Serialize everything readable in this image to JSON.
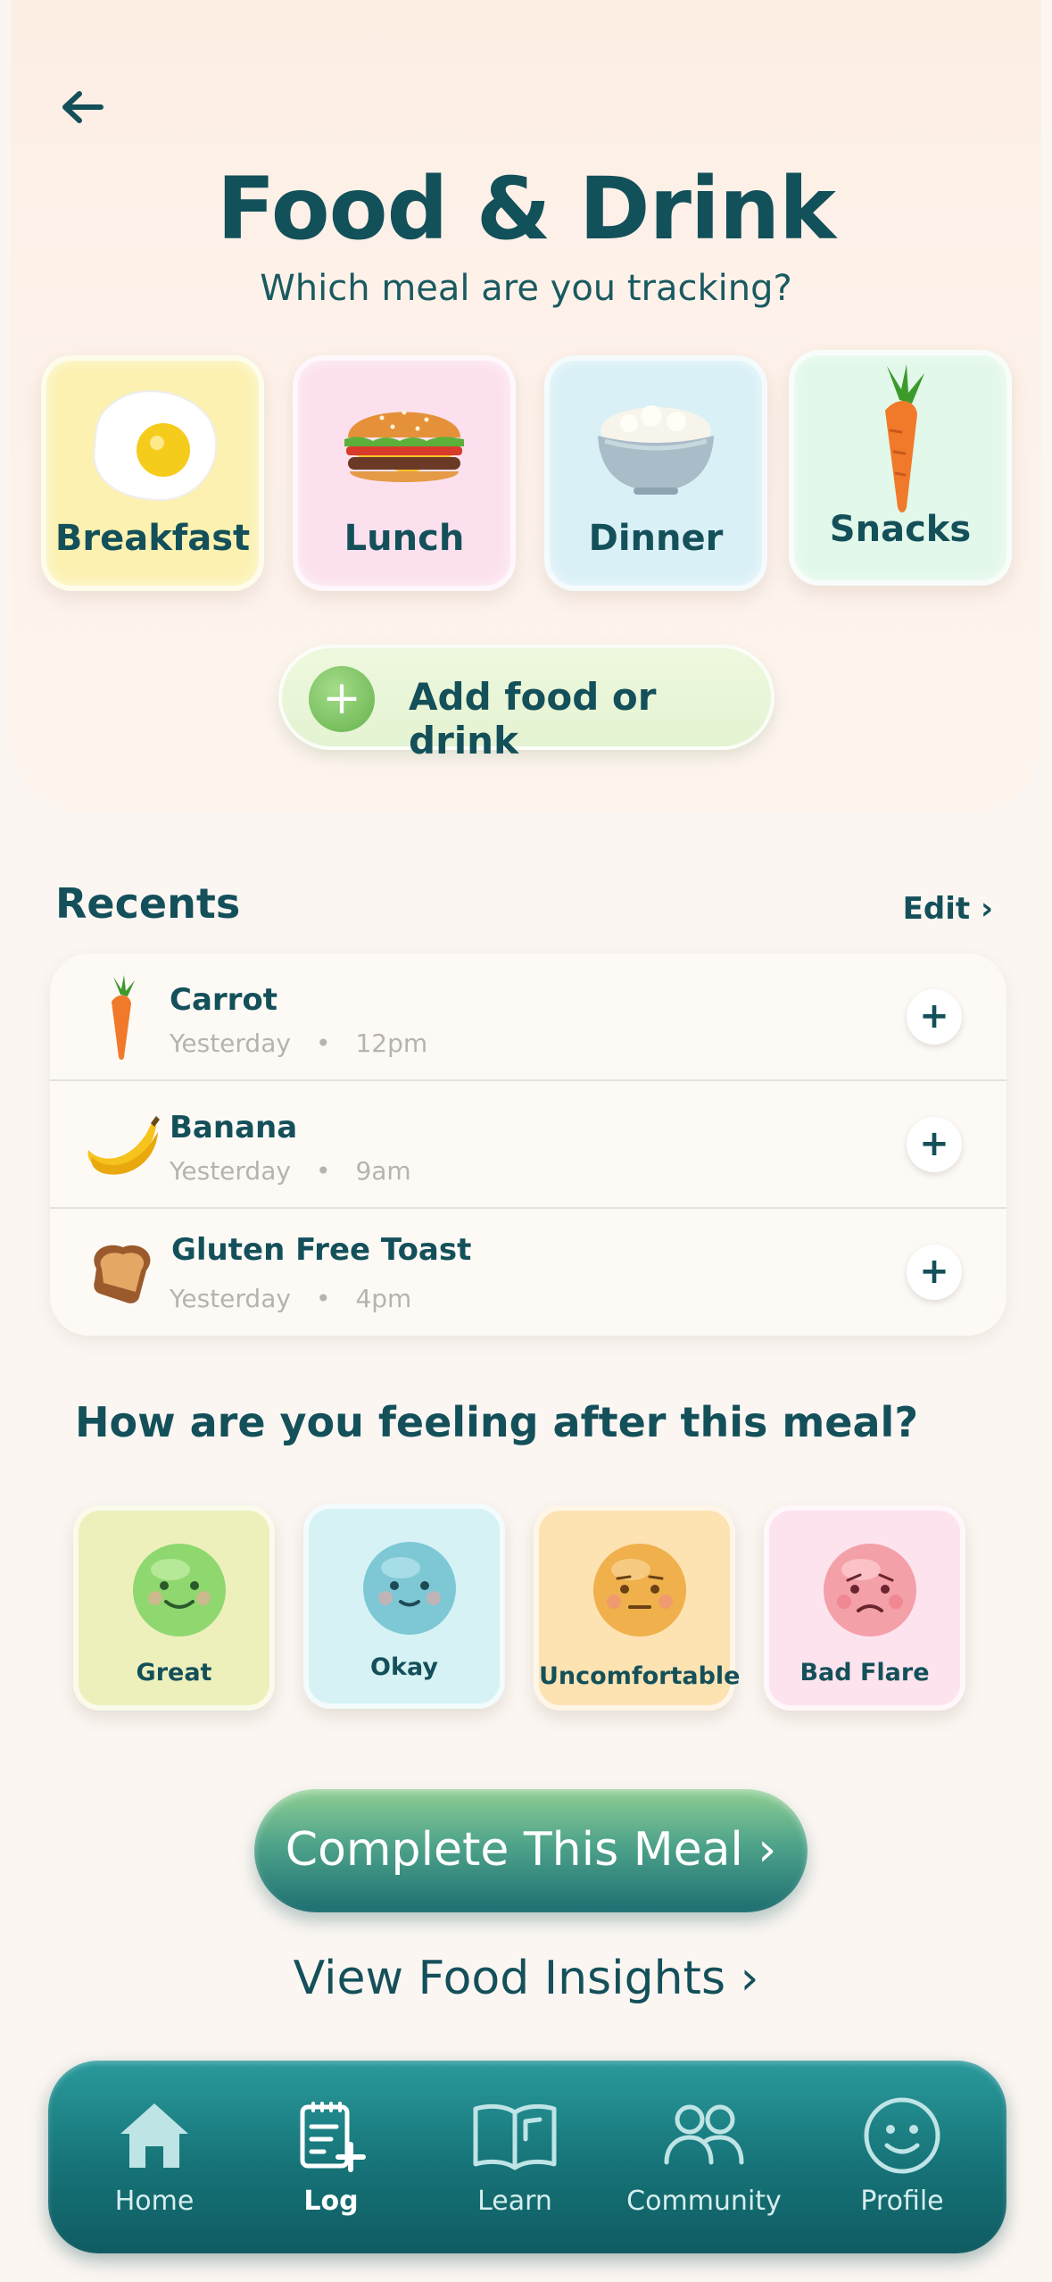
{
  "header": {
    "back_icon": "arrow-left-icon",
    "title": "Food & Drink",
    "subtitle": "Which meal are you tracking?"
  },
  "meals": [
    {
      "label": "Breakfast",
      "icon": "fried-egg-icon",
      "color": "#fcf3b4"
    },
    {
      "label": "Lunch",
      "icon": "burger-icon",
      "color": "#fce0ee"
    },
    {
      "label": "Dinner",
      "icon": "rice-bowl-icon",
      "color": "#d8f0f6"
    },
    {
      "label": "Snacks",
      "icon": "carrot-icon",
      "color": "#e2f8ea"
    }
  ],
  "add_button": {
    "label": "Add food or drink"
  },
  "recents": {
    "title": "Recents",
    "edit_label": "Edit ›",
    "items": [
      {
        "name": "Carrot",
        "day": "Yesterday",
        "time": "12pm",
        "icon": "carrot-icon"
      },
      {
        "name": "Banana",
        "day": "Yesterday",
        "time": "9am",
        "icon": "banana-icon"
      },
      {
        "name": "Gluten Free Toast",
        "day": "Yesterday",
        "time": "4pm",
        "icon": "toast-icon"
      }
    ]
  },
  "feeling": {
    "title": "How are you feeling after this meal?",
    "options": [
      {
        "label": "Great",
        "icon": "happy-face-icon",
        "color": "#eef0bc"
      },
      {
        "label": "Okay",
        "icon": "content-face-icon",
        "color": "#d6f2f4"
      },
      {
        "label": "Uncomfortable",
        "icon": "neutral-face-icon",
        "color": "#fde2b2"
      },
      {
        "label": "Bad Flare",
        "icon": "sad-face-icon",
        "color": "#fde3ee"
      }
    ]
  },
  "actions": {
    "complete_label": "Complete This Meal ›",
    "insights_label": "View Food Insights ›"
  },
  "tabbar": {
    "active": "Log",
    "tabs": [
      {
        "label": "Home",
        "icon": "home-icon"
      },
      {
        "label": "Log",
        "icon": "clipboard-add-icon"
      },
      {
        "label": "Learn",
        "icon": "book-icon"
      },
      {
        "label": "Community",
        "icon": "people-icon"
      },
      {
        "label": "Profile",
        "icon": "smiley-profile-icon"
      }
    ]
  }
}
